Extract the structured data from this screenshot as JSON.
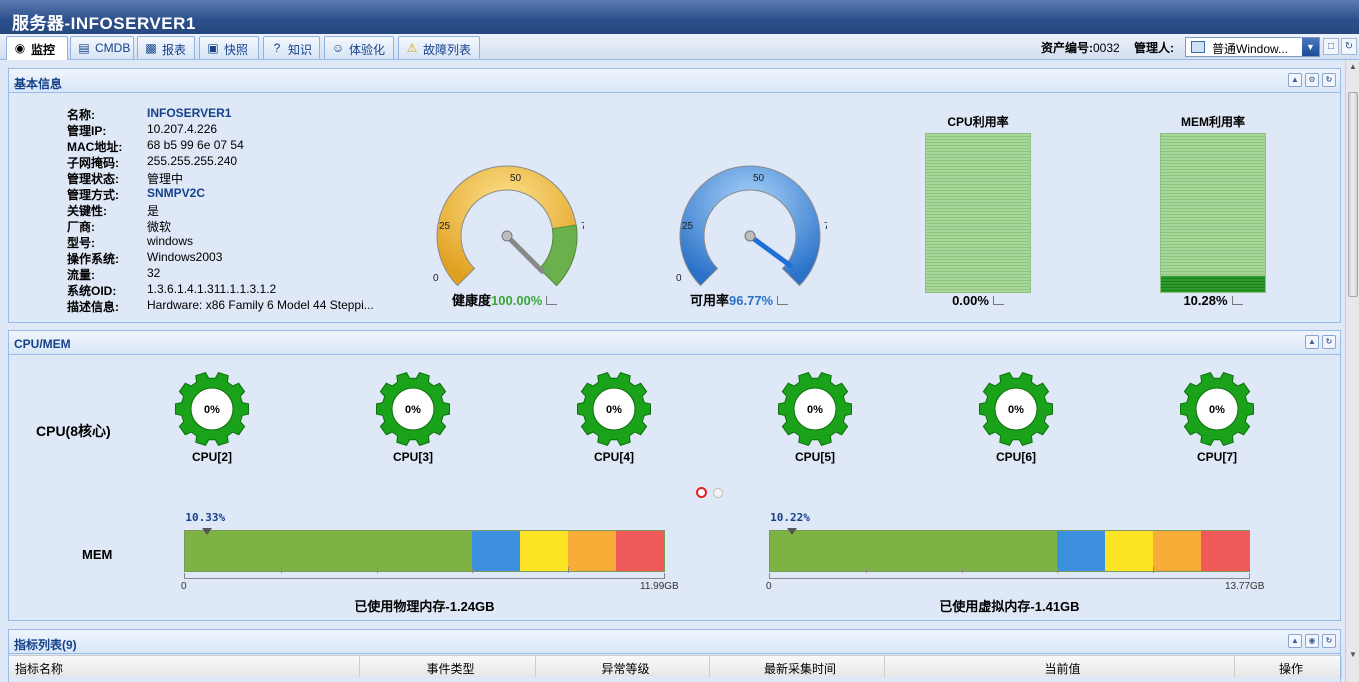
{
  "window": {
    "title": "服务器-INFOSERVER1"
  },
  "tabs": [
    {
      "label": "监控",
      "icon": "binoculars-icon"
    },
    {
      "label": "CMDB",
      "icon": "database-icon"
    },
    {
      "label": "报表",
      "icon": "report-icon"
    },
    {
      "label": "快照",
      "icon": "snapshot-icon"
    },
    {
      "label": "知识",
      "icon": "knowledge-icon"
    },
    {
      "label": "体验化",
      "icon": "experience-icon"
    },
    {
      "label": "故障列表",
      "icon": "warning-icon"
    }
  ],
  "toolbar": {
    "asset_label": "资产编号:",
    "asset_no": "0032",
    "owner_label": "管理人:",
    "owner_value": "普通Window..."
  },
  "basic": {
    "title": "基本信息",
    "fields": [
      {
        "label": "名称:",
        "value": "INFOSERVER1",
        "link": true
      },
      {
        "label": "管理IP:",
        "value": "10.207.4.226"
      },
      {
        "label": "MAC地址:",
        "value": "68 b5 99 6e 07 54"
      },
      {
        "label": "子网掩码:",
        "value": "255.255.255.240"
      },
      {
        "label": "管理状态:",
        "value": "管理中"
      },
      {
        "label": "管理方式:",
        "value": "SNMPV2C",
        "link": true
      },
      {
        "label": "关键性:",
        "value": "是"
      },
      {
        "label": "厂商:",
        "value": "微软"
      },
      {
        "label": "型号:",
        "value": "windows"
      },
      {
        "label": "操作系统:",
        "value": "Windows2003"
      },
      {
        "label": "流量:",
        "value": "32"
      },
      {
        "label": "系统OID:",
        "value": "1.3.6.1.4.1.311.1.1.3.1.2"
      },
      {
        "label": "描述信息:",
        "value": "Hardware: x86 Family 6 Model 44 Steppi..."
      }
    ],
    "health": {
      "label": "健康度",
      "value": "100.00%",
      "fraction": 1.0,
      "ticks": [
        "0",
        "25",
        "50",
        "75",
        "100"
      ],
      "color": "#e0a020"
    },
    "availability": {
      "label": "可用率",
      "value": "96.77%",
      "fraction": 0.9677,
      "ticks": [
        "0",
        "25",
        "50",
        "75",
        "100"
      ],
      "color": "#2a72c8"
    },
    "cpu_usage": {
      "title": "CPU利用率",
      "value": "0.00%",
      "fraction": 0.0
    },
    "mem_usage": {
      "title": "MEM利用率",
      "value": "10.28%",
      "fraction": 0.1028
    }
  },
  "cpumem": {
    "title": "CPU/MEM",
    "cpu_label": "CPU(8核心)",
    "cores": [
      {
        "name": "CPU[2]",
        "value": "0%"
      },
      {
        "name": "CPU[3]",
        "value": "0%"
      },
      {
        "name": "CPU[4]",
        "value": "0%"
      },
      {
        "name": "CPU[5]",
        "value": "0%"
      },
      {
        "name": "CPU[6]",
        "value": "0%"
      },
      {
        "name": "CPU[7]",
        "value": "0%"
      }
    ],
    "mem_label": "MEM",
    "physical": {
      "pct": "10.33%",
      "fraction": 0.1033,
      "min": "0",
      "max": "11.99GB",
      "caption": "已使用物理内存-1.24GB"
    },
    "virtual": {
      "pct": "10.22%",
      "fraction": 0.1022,
      "min": "0",
      "max": "13.77GB",
      "caption": "已使用虚拟内存-1.41GB"
    },
    "colors": {
      "green": "#7cb342",
      "blue": "#3d8fe0",
      "yellow": "#fde526",
      "orange": "#f8ad38",
      "red": "#f15a5a"
    }
  },
  "metrics": {
    "title": "指标列表(9)",
    "columns": [
      "指标名称",
      "事件类型",
      "异常等级",
      "最新采集时间",
      "当前值",
      "操作"
    ]
  }
}
